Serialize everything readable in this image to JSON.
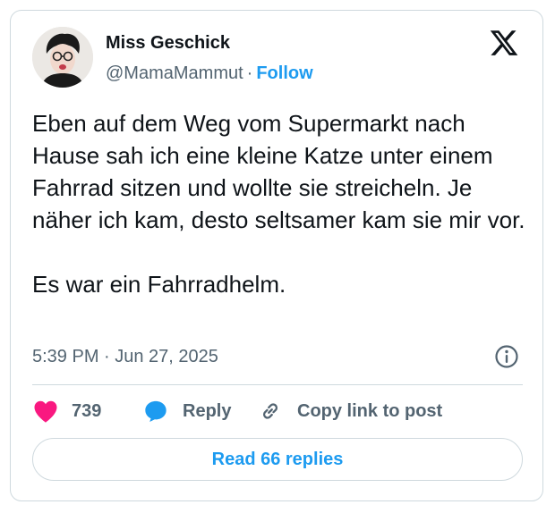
{
  "author": {
    "display_name": "Miss Geschick",
    "handle": "@MamaMammut",
    "separator": "·",
    "follow_label": "Follow"
  },
  "tweet": {
    "paragraphs": [
      "Eben auf dem Weg vom Supermarkt nach Hause sah ich eine kleine Katze unter einem Fahrrad sitzen und wollte sie streicheln. Je näher ich kam, desto seltsamer kam sie mir vor.",
      "Es war ein Fahrradhelm."
    ],
    "timestamp": "5:39 PM · Jun 27, 2025"
  },
  "actions": {
    "like_count": "739",
    "reply_label": "Reply",
    "copy_label": "Copy link to post"
  },
  "read_replies_label": "Read 66 replies",
  "icons": {
    "logo": "x-logo-icon",
    "info": "info-icon",
    "like": "heart-icon",
    "reply": "speech-bubble-icon",
    "copy": "link-icon"
  },
  "colors": {
    "accent": "#1d9bf0",
    "like": "#f91880",
    "text": "#0f1419",
    "muted": "#536471",
    "border": "#cfd9de"
  }
}
